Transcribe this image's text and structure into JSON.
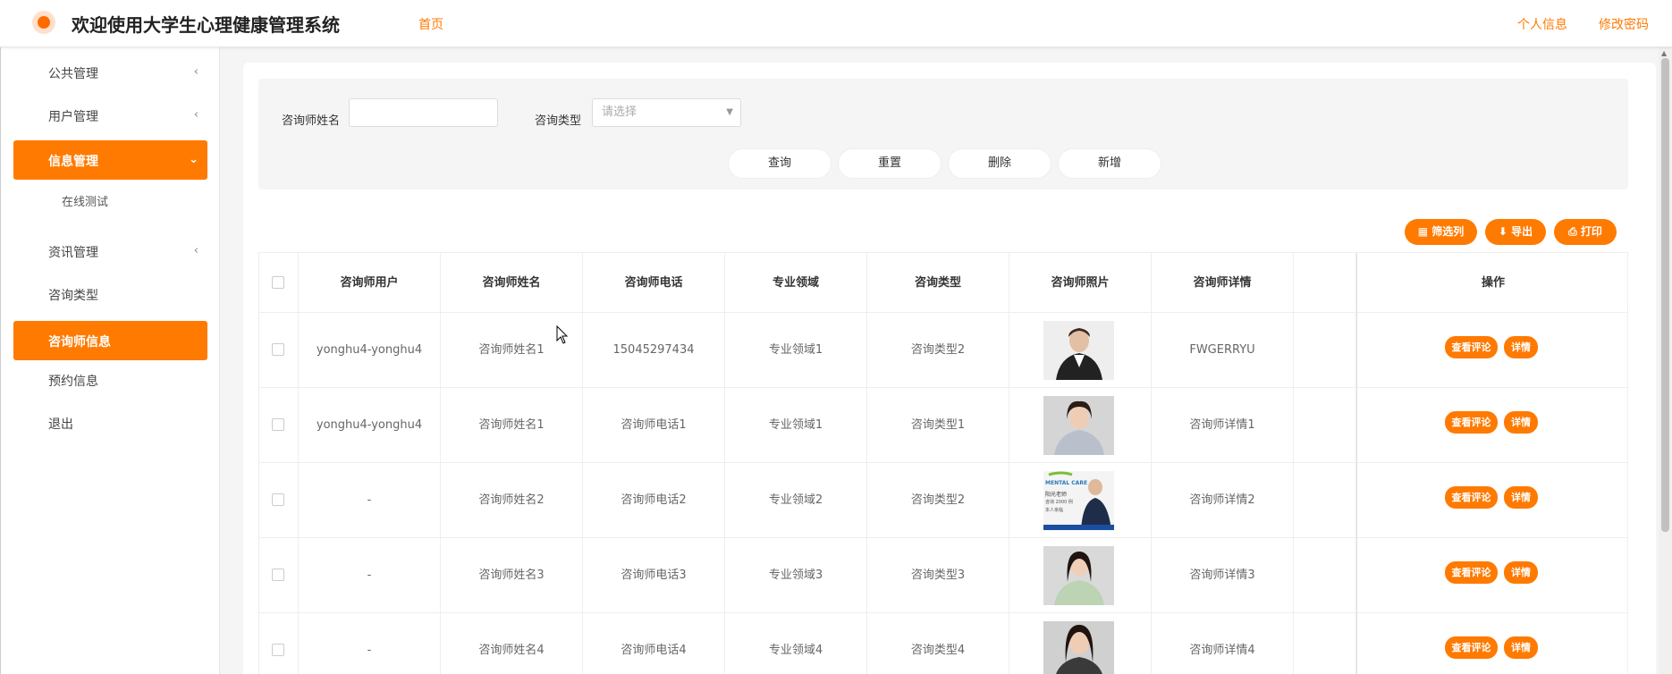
{
  "header": {
    "title": "欢迎使用大学生心理健康管理系统",
    "home": "首页",
    "profile": "个人信息",
    "change_password": "修改密码"
  },
  "sidebar": {
    "items": [
      {
        "label": "公共管理"
      },
      {
        "label": "用户管理"
      },
      {
        "label": "信息管理"
      },
      {
        "label": "在线测试"
      },
      {
        "label": "资讯管理"
      },
      {
        "label": "咨询类型"
      },
      {
        "label": "咨询师信息"
      },
      {
        "label": "预约信息"
      },
      {
        "label": "退出"
      }
    ]
  },
  "search": {
    "name_label": "咨询师姓名",
    "name_value": "",
    "type_label": "咨询类型",
    "type_placeholder": "请选择",
    "query": "查询",
    "reset": "重置",
    "delete": "删除",
    "add": "新增"
  },
  "toolbar": {
    "filter": "筛选列",
    "export": "导出",
    "print": "打印"
  },
  "table": {
    "columns": [
      "咨询师用户",
      "咨询师姓名",
      "咨询师电话",
      "专业领域",
      "咨询类型",
      "咨询师照片",
      "咨询师详情",
      "",
      "操作"
    ],
    "rows": [
      {
        "user": "yonghu4-yonghu4",
        "name": "咨询师姓名1",
        "phone": "15045297434",
        "field": "专业领域1",
        "type": "咨询类型2",
        "detail": "FWGERRYU"
      },
      {
        "user": "yonghu4-yonghu4",
        "name": "咨询师姓名1",
        "phone": "咨询师电话1",
        "field": "专业领域1",
        "type": "咨询类型1",
        "detail": "咨询师详情1"
      },
      {
        "user": "-",
        "name": "咨询师姓名2",
        "phone": "咨询师电话2",
        "field": "专业领域2",
        "type": "咨询类型2",
        "detail": "咨询师详情2"
      },
      {
        "user": "-",
        "name": "咨询师姓名3",
        "phone": "咨询师电话3",
        "field": "专业领域3",
        "type": "咨询类型3",
        "detail": "咨询师详情3"
      },
      {
        "user": "-",
        "name": "咨询师姓名4",
        "phone": "咨询师电话4",
        "field": "专业领域4",
        "type": "咨询类型4",
        "detail": "咨询师详情4"
      }
    ],
    "view_comments": "查看评论",
    "details": "详情"
  },
  "photo3_caption": {
    "brand": "MENTAL CARE",
    "line1": "阳光老师",
    "line2": "咨询 2000 例",
    "line3": "本人亲临"
  },
  "colors": {
    "accent": "#ff7a00"
  }
}
